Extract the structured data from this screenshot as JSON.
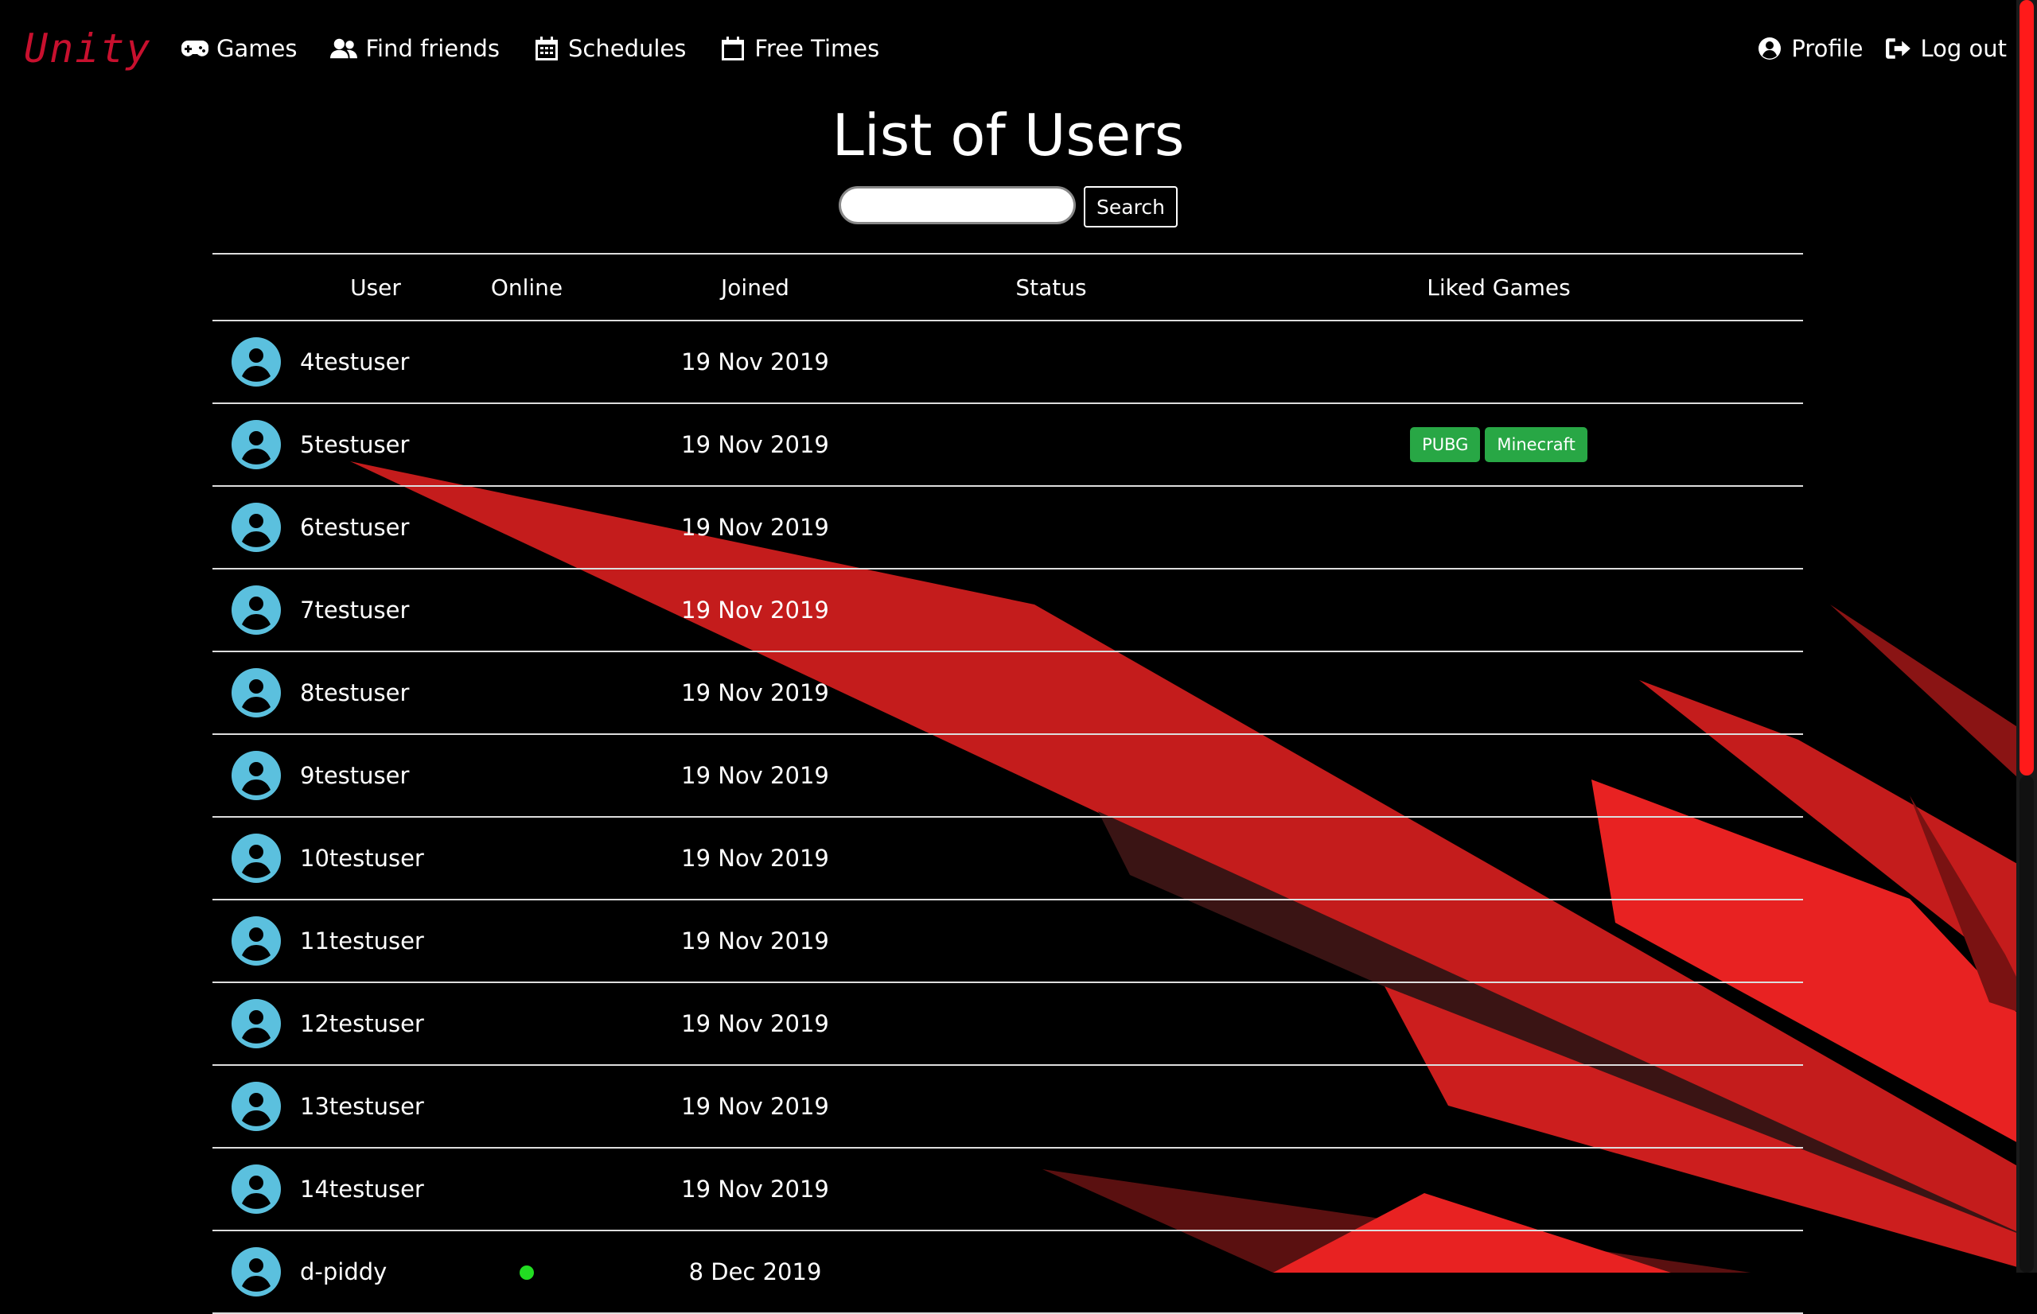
{
  "nav": {
    "brand": "Unity",
    "left": [
      {
        "label": "Games",
        "icon": "gamepad-icon"
      },
      {
        "label": "Find friends",
        "icon": "users-icon"
      },
      {
        "label": "Schedules",
        "icon": "calendar-grid-icon"
      },
      {
        "label": "Free Times",
        "icon": "calendar-blank-icon"
      }
    ],
    "right": [
      {
        "label": "Profile",
        "icon": "user-circle-icon"
      },
      {
        "label": "Log out",
        "icon": "sign-out-icon"
      }
    ]
  },
  "page": {
    "title": "List of Users"
  },
  "search": {
    "placeholder": "",
    "value": "",
    "button_label": "Search"
  },
  "table": {
    "headers": {
      "user": "User",
      "online": "Online",
      "joined": "Joined",
      "status": "Status",
      "liked_games": "Liked Games"
    },
    "rows": [
      {
        "username": "4testuser",
        "online": false,
        "joined": "19 Nov 2019",
        "status": "",
        "liked_games": []
      },
      {
        "username": "5testuser",
        "online": false,
        "joined": "19 Nov 2019",
        "status": "",
        "liked_games": [
          "PUBG",
          "Minecraft"
        ]
      },
      {
        "username": "6testuser",
        "online": false,
        "joined": "19 Nov 2019",
        "status": "",
        "liked_games": []
      },
      {
        "username": "7testuser",
        "online": false,
        "joined": "19 Nov 2019",
        "status": "",
        "liked_games": []
      },
      {
        "username": "8testuser",
        "online": false,
        "joined": "19 Nov 2019",
        "status": "",
        "liked_games": []
      },
      {
        "username": "9testuser",
        "online": false,
        "joined": "19 Nov 2019",
        "status": "",
        "liked_games": []
      },
      {
        "username": "10testuser",
        "online": false,
        "joined": "19 Nov 2019",
        "status": "",
        "liked_games": []
      },
      {
        "username": "11testuser",
        "online": false,
        "joined": "19 Nov 2019",
        "status": "",
        "liked_games": []
      },
      {
        "username": "12testuser",
        "online": false,
        "joined": "19 Nov 2019",
        "status": "",
        "liked_games": []
      },
      {
        "username": "13testuser",
        "online": false,
        "joined": "19 Nov 2019",
        "status": "",
        "liked_games": []
      },
      {
        "username": "14testuser",
        "online": false,
        "joined": "19 Nov 2019",
        "status": "",
        "liked_games": []
      },
      {
        "username": "d-piddy",
        "online": true,
        "joined": "8 Dec 2019",
        "status": "",
        "liked_games": []
      }
    ]
  },
  "colors": {
    "brand": "#c8102e",
    "avatar": "#5bc0de",
    "badge": "#28a745",
    "online": "#22dd22",
    "background_art": "#e02020",
    "scrollbar_thumb": "#ff1a1a"
  }
}
